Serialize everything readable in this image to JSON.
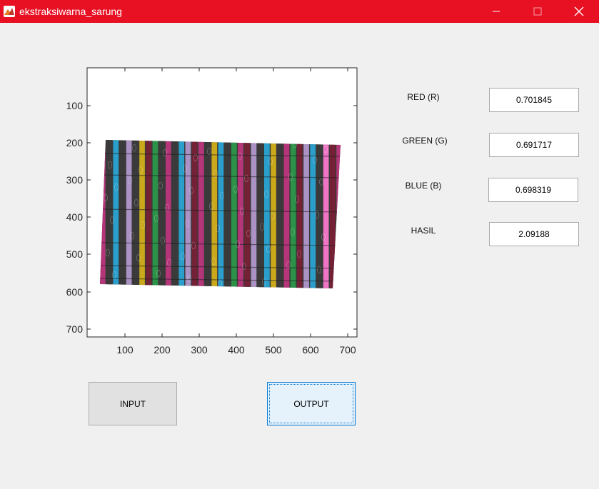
{
  "window": {
    "title": "ekstraksiwarna_sarung"
  },
  "titlebar_icons": {
    "app": "matlab-logo-icon",
    "minimize": "minimize-icon",
    "maximize": "maximize-icon",
    "close": "close-icon"
  },
  "axes": {
    "x_ticks": [
      "100",
      "200",
      "300",
      "400",
      "500",
      "600",
      "700"
    ],
    "y_ticks": [
      "100",
      "200",
      "300",
      "400",
      "500",
      "600",
      "700"
    ]
  },
  "image": {
    "subject": "sarung-image",
    "stripe_colors": [
      "#c0357f",
      "#2aa8d8",
      "#b49ad0",
      "#d6b21a",
      "#2a9a4a",
      "#7a2036",
      "#ff7ad0",
      "#3a3a3a"
    ]
  },
  "results": {
    "red_label": "RED (R)",
    "red_value": "0.701845",
    "green_label": "GREEN (G)",
    "green_value": "0.691717",
    "blue_label": "BLUE (B)",
    "blue_value": "0.698319",
    "hasil_label": "HASIL",
    "hasil_value": "2.09188"
  },
  "buttons": {
    "input_label": "INPUT",
    "output_label": "OUTPUT"
  }
}
